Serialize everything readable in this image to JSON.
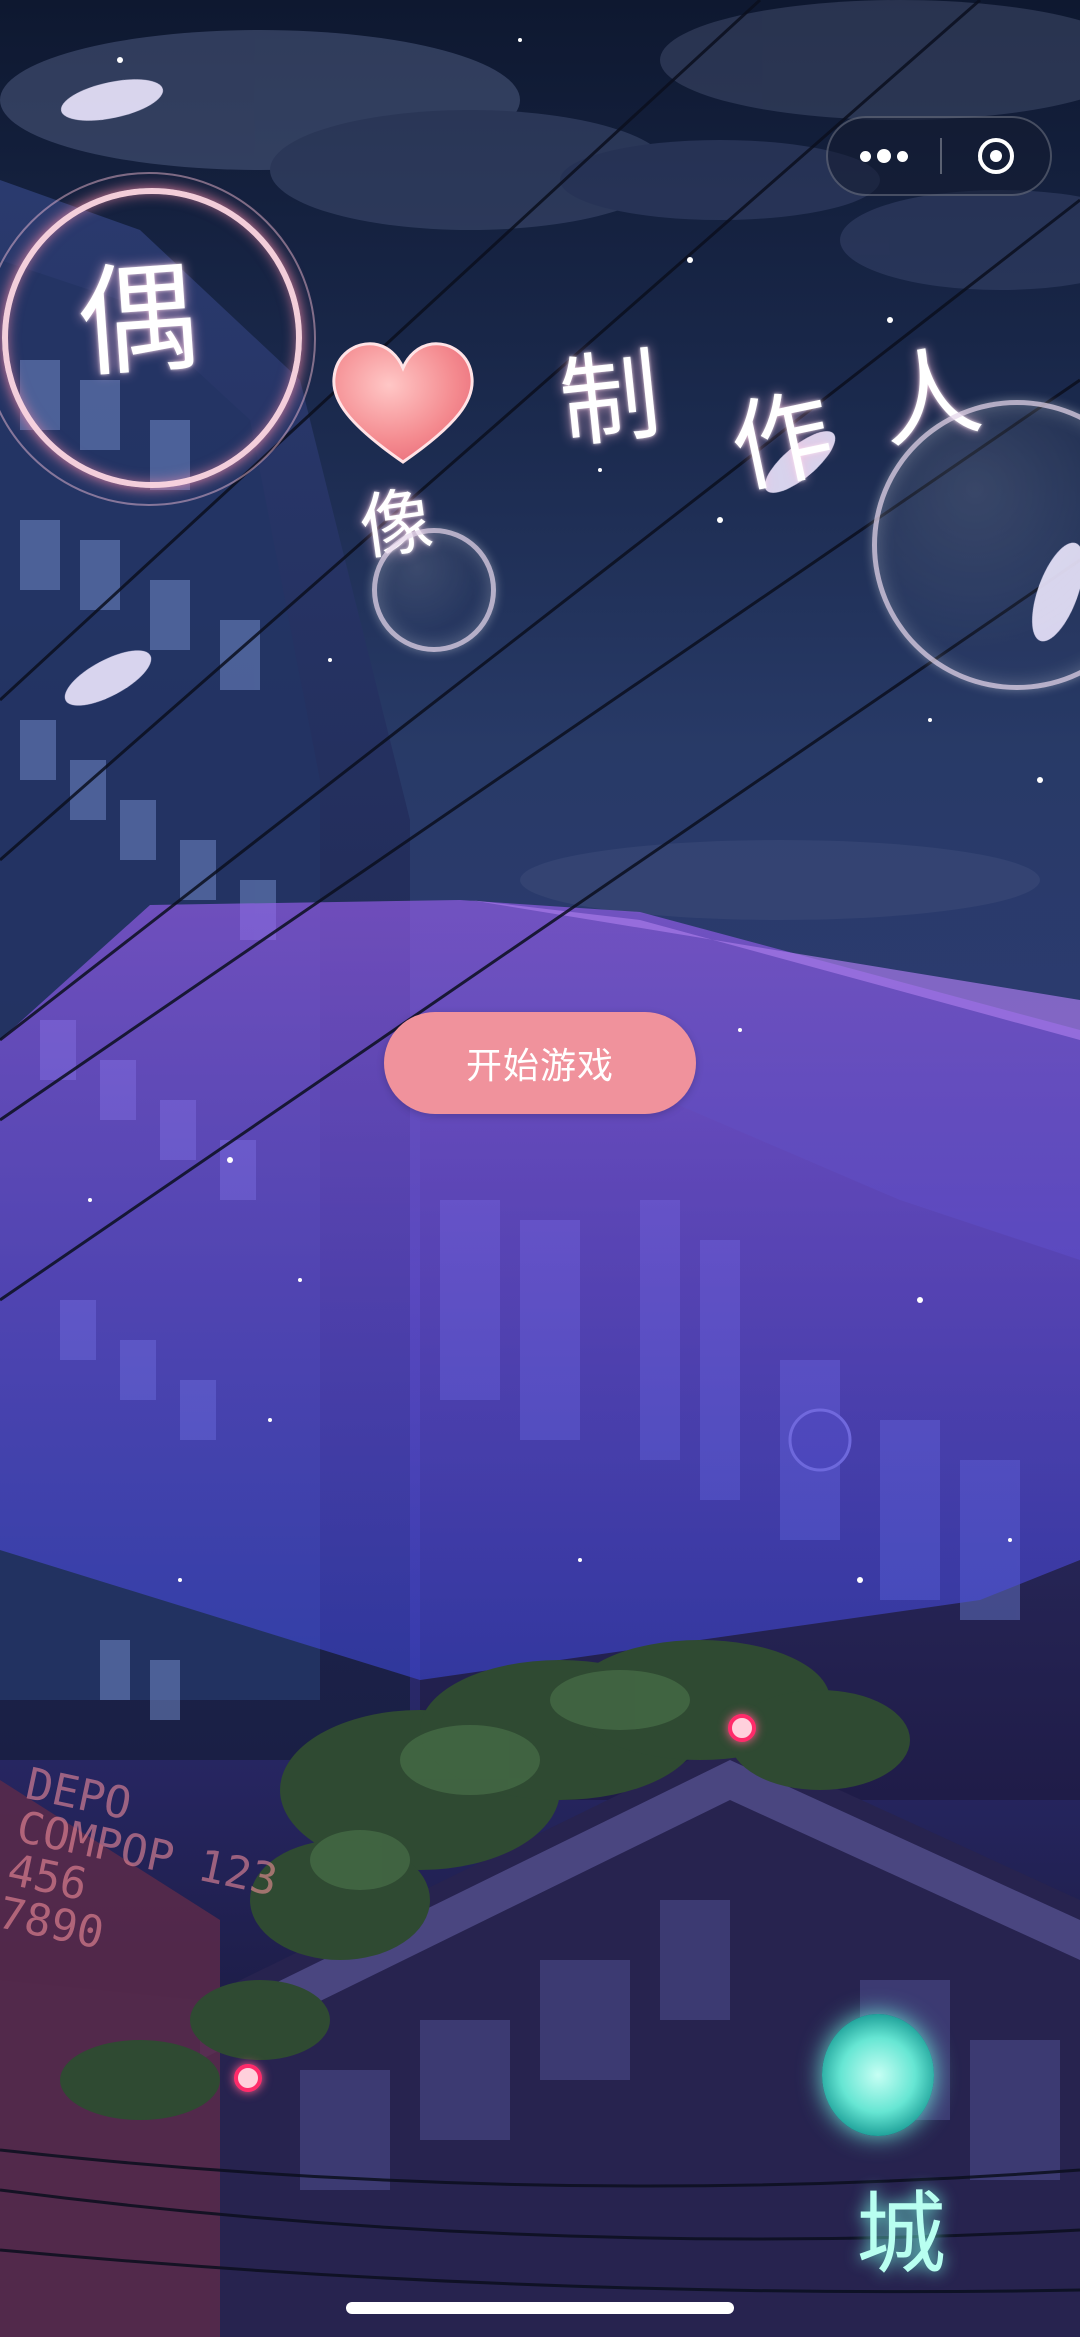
{
  "title": {
    "chars": [
      "偶",
      "像",
      "制",
      "作",
      "人"
    ]
  },
  "start_button": {
    "label": "开始游戏"
  },
  "capsule_menu": {
    "more_icon": "more-dots-icon",
    "close_icon": "target-close-icon"
  },
  "background": {
    "billboard_text": "DEPO\nCOMPOP 123\n456\n7890",
    "neon_glyph": "城"
  },
  "colors": {
    "button_fill": "#f0929c",
    "heart": "#f48a8f",
    "purple_overlay": "#7b4fe0"
  }
}
